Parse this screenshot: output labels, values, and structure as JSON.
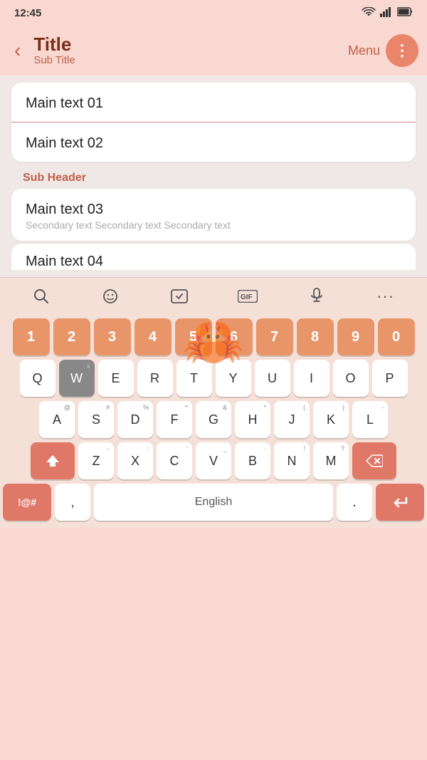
{
  "statusBar": {
    "time": "12:45",
    "wifiIcon": "📶",
    "signalIcon": "📶",
    "batteryIcon": "🔋"
  },
  "appBar": {
    "backLabel": "‹",
    "title": "Title",
    "subtitle": "Sub Title",
    "menuLabel": "Menu",
    "dotMenuIcon": "⋮"
  },
  "content": {
    "items": [
      {
        "mainText": "Main text 01",
        "secondaryText": "",
        "hasSecondary": false
      },
      {
        "mainText": "Main text 02",
        "secondaryText": "",
        "hasSecondary": false
      }
    ],
    "subHeader": "Sub Header",
    "items2": [
      {
        "mainText": "Main text 03",
        "secondaryText": "Secondary text Secondary text Secondary text",
        "hasSecondary": true
      },
      {
        "mainText": "Main text 04",
        "secondaryText": "",
        "hasSecondary": false
      }
    ]
  },
  "keyboard": {
    "toolbar": {
      "searchIcon": "🔍",
      "emojiIcon": "🙂",
      "stickerIcon": "🎭",
      "gifLabel": "GIF",
      "micIcon": "🎤",
      "moreIcon": "···"
    },
    "numRow": [
      "1",
      "2",
      "3",
      "4",
      "5",
      "6",
      "7",
      "8",
      "9",
      "0"
    ],
    "numSub": [
      "+",
      "",
      "÷",
      "=",
      "/",
      "-",
      "<",
      ">",
      "[",
      "]"
    ],
    "row1": [
      "Q",
      "W",
      "E",
      "R",
      "T",
      "Y",
      "U",
      "I",
      "O",
      "P"
    ],
    "row1sub": [
      "",
      "x",
      "",
      "",
      "",
      "",
      "",
      "",
      "",
      ""
    ],
    "row2": [
      "A",
      "S",
      "D",
      "F",
      "G",
      "H",
      "J",
      "K",
      "L"
    ],
    "row2sub": [
      "@",
      "#",
      "%",
      "^",
      "&",
      "*",
      "(",
      ")",
      "-"
    ],
    "row3": [
      "Z",
      "X",
      "C",
      "V",
      "B",
      "N",
      "M"
    ],
    "row3sub": [
      "-",
      ":",
      "'",
      "_",
      "·",
      "!",
      "?"
    ],
    "specialLeft": "!@#",
    "comma": ",",
    "spaceLabel": "English",
    "period": ".",
    "enterIcon": "↵",
    "shiftIcon": "⇧",
    "backspaceIcon": "⌫"
  }
}
